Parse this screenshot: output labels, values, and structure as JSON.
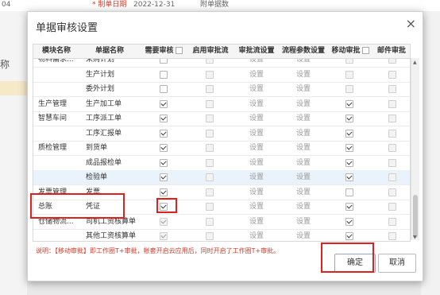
{
  "background": {
    "top_left": "04",
    "date_label": "* 制单日期",
    "date_value": "2022-12-31",
    "attach_label": "附单据数",
    "side_label": "称"
  },
  "dialog": {
    "title": "单据审核设置",
    "close": "×",
    "headers": [
      "模块名称",
      "单据名称",
      "需要审核",
      "启用审批流",
      "审批流设置",
      "流程参数设置",
      "移动审批",
      "邮件审批"
    ],
    "link_label": "设置",
    "rows": [
      {
        "module": "物料需求...",
        "doc": "采购计划",
        "audit": false,
        "flow": false,
        "mobile": false,
        "mail": false,
        "audit_dis": false,
        "highlight": false
      },
      {
        "module": "",
        "doc": "生产计划",
        "audit": false,
        "flow": false,
        "mobile": false,
        "mail": false,
        "audit_dis": false,
        "highlight": false
      },
      {
        "module": "",
        "doc": "委外计划",
        "audit": false,
        "flow": false,
        "mobile": false,
        "mail": false,
        "audit_dis": false,
        "highlight": false
      },
      {
        "module": "生产管理",
        "doc": "生产加工单",
        "audit": true,
        "flow": false,
        "mobile": true,
        "mail": false,
        "audit_dis": false,
        "highlight": false
      },
      {
        "module": "智慧车间",
        "doc": "工序派工单",
        "audit": true,
        "flow": false,
        "mobile": true,
        "mail": false,
        "audit_dis": false,
        "highlight": false
      },
      {
        "module": "",
        "doc": "工序汇报单",
        "audit": true,
        "flow": false,
        "mobile": true,
        "mail": false,
        "audit_dis": false,
        "highlight": false
      },
      {
        "module": "质检管理",
        "doc": "到货单",
        "audit": true,
        "flow": false,
        "mobile": true,
        "mail": false,
        "audit_dis": false,
        "highlight": false
      },
      {
        "module": "",
        "doc": "成品报检单",
        "audit": true,
        "flow": false,
        "mobile": true,
        "mail": false,
        "audit_dis": false,
        "highlight": false
      },
      {
        "module": "",
        "doc": "检验单",
        "audit": true,
        "flow": false,
        "mobile": true,
        "mail": false,
        "audit_dis": false,
        "highlight": true
      },
      {
        "module": "发票管理",
        "doc": "发票",
        "audit": true,
        "flow": false,
        "mobile": false,
        "mail": false,
        "audit_dis": false,
        "highlight": false
      },
      {
        "module": "总账",
        "doc": "凭证",
        "audit": true,
        "flow": false,
        "mobile": true,
        "mail": false,
        "audit_dis": false,
        "highlight": false
      },
      {
        "module": "仓储物流...",
        "doc": "司机工资核算单",
        "audit": true,
        "flow": false,
        "mobile": true,
        "mail": false,
        "audit_dis": true,
        "highlight": false
      },
      {
        "module": "",
        "doc": "其他工资核算单",
        "audit": true,
        "flow": false,
        "mobile": true,
        "mail": false,
        "audit_dis": true,
        "highlight": false
      }
    ],
    "note": "说明：【移动审批】即工作圈T+审批，帐套开启云应用后，同时开启了工作圈T+审批。",
    "ok_label": "确定",
    "cancel_label": "取消"
  },
  "colors": {
    "annotation_red": "#e0201c",
    "note_red": "#d23a2a",
    "highlight_row": "#eaf2fc"
  }
}
